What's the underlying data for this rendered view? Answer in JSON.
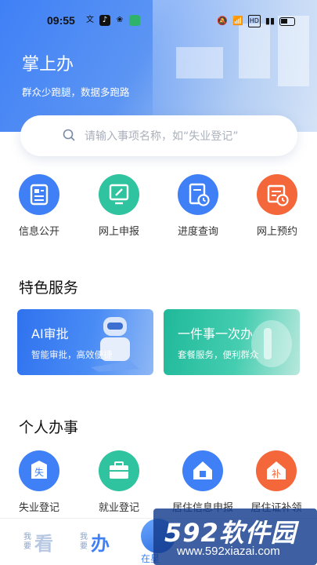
{
  "status_bar": {
    "time": "09:55"
  },
  "header": {
    "title": "掌上办",
    "subtitle": "群众少跑腿，数据多跑路"
  },
  "search": {
    "placeholder": "请输入事项名称，如“失业登记”"
  },
  "quick_actions": [
    {
      "label": "信息公开",
      "icon": "document-list-icon",
      "color": "#3f80f6"
    },
    {
      "label": "网上申报",
      "icon": "edit-screen-icon",
      "color": "#2fc3a0"
    },
    {
      "label": "进度查询",
      "icon": "clock-document-icon",
      "color": "#3f80f6"
    },
    {
      "label": "网上预约",
      "icon": "calendar-clock-icon",
      "color": "#f4673a"
    }
  ],
  "featured": {
    "title": "特色服务",
    "cards": [
      {
        "title": "AI审批",
        "subtitle": "智能审批，高效便捷",
        "color": "#3f80f6"
      },
      {
        "title": "一件事一次办",
        "subtitle": "套餐服务，便利群众",
        "color": "#2fc3a0"
      }
    ]
  },
  "personal": {
    "title": "个人办事",
    "items": [
      {
        "label": "失业登记",
        "icon": "unemployment-icon",
        "glyph": "失",
        "color": "#3f80f6"
      },
      {
        "label": "就业登记",
        "icon": "briefcase-icon",
        "glyph": "",
        "color": "#2fc3a0"
      },
      {
        "label": "居住信息申报",
        "icon": "house-icon",
        "glyph": "",
        "color": "#3f80f6"
      },
      {
        "label": "居住证补领",
        "icon": "reissue-icon",
        "glyph": "补",
        "color": "#f4673a"
      }
    ]
  },
  "bottom_nav": {
    "look": {
      "small": "我要",
      "big": "看"
    },
    "do": {
      "small": "我要",
      "big": "办"
    },
    "center_label": "在星"
  },
  "watermark": {
    "brand": "592软件园",
    "url": "www.592xiazai.com"
  }
}
